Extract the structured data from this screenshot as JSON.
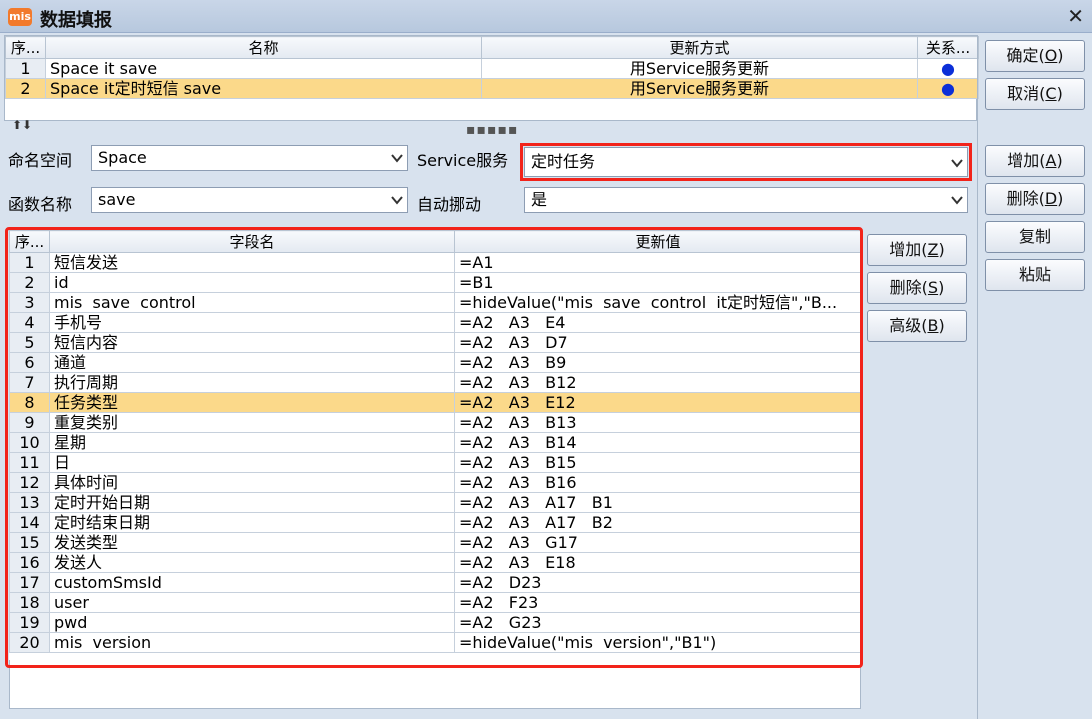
{
  "window": {
    "title": "数据填报",
    "icon_text": "mis"
  },
  "top_table": {
    "headers": [
      "序...",
      "名称",
      "更新方式",
      "关系..."
    ],
    "rows": [
      {
        "no": "1",
        "name": "Space  it  save",
        "mode": "用Service服务更新",
        "rel": "●"
      },
      {
        "no": "2",
        "name": "Space  it定时短信  save",
        "mode": "用Service服务更新",
        "rel": "●"
      }
    ],
    "selected_row": 1
  },
  "buttons_right": {
    "ok": "确定(O)",
    "cancel": "取消(C)",
    "add": "增加(A)",
    "delete": "删除(D)",
    "copy": "复制",
    "paste": "粘贴"
  },
  "form": {
    "namespace_label": "命名空间",
    "namespace_value": "Space",
    "service_label": "Service服务",
    "service_value": "定时任务",
    "function_label": "函数名称",
    "function_value": "save",
    "auto_label": "自动挪动",
    "auto_value": "是"
  },
  "field_buttons": {
    "add": "增加(Z)",
    "delete": "删除(S)",
    "advanced": "高级(B)"
  },
  "field_table": {
    "headers": [
      "序...",
      "字段名",
      "更新值"
    ],
    "selected_row": 7,
    "rows": [
      {
        "no": "1",
        "field": "短信发送",
        "value": "=A1"
      },
      {
        "no": "2",
        "field": "id",
        "value": "=B1"
      },
      {
        "no": "3",
        "field": "mis  save  control",
        "value": "=hideValue(\"mis  save  control  it定时短信\",\"B..."
      },
      {
        "no": "4",
        "field": "手机号",
        "value": "=A2   A3   E4"
      },
      {
        "no": "5",
        "field": "短信内容",
        "value": "=A2   A3   D7"
      },
      {
        "no": "6",
        "field": "通道",
        "value": "=A2   A3   B9"
      },
      {
        "no": "7",
        "field": "执行周期",
        "value": "=A2   A3   B12"
      },
      {
        "no": "8",
        "field": "任务类型",
        "value": "=A2   A3   E12"
      },
      {
        "no": "9",
        "field": "重复类别",
        "value": "=A2   A3   B13"
      },
      {
        "no": "10",
        "field": "星期",
        "value": "=A2   A3   B14"
      },
      {
        "no": "11",
        "field": "日",
        "value": "=A2   A3   B15"
      },
      {
        "no": "12",
        "field": "具体时间",
        "value": "=A2   A3   B16"
      },
      {
        "no": "13",
        "field": "定时开始日期",
        "value": "=A2   A3   A17   B1"
      },
      {
        "no": "14",
        "field": "定时结束日期",
        "value": "=A2   A3   A17   B2"
      },
      {
        "no": "15",
        "field": "发送类型",
        "value": "=A2   A3   G17"
      },
      {
        "no": "16",
        "field": "发送人",
        "value": "=A2   A3   E18"
      },
      {
        "no": "17",
        "field": "customSmsId",
        "value": "=A2   D23"
      },
      {
        "no": "18",
        "field": "user",
        "value": "=A2   F23"
      },
      {
        "no": "19",
        "field": "pwd",
        "value": "=A2   G23"
      },
      {
        "no": "20",
        "field": "mis  version",
        "value": "=hideValue(\"mis  version\",\"B1\")"
      }
    ]
  },
  "colors": {
    "accent_highlight": "#f2231a",
    "selected_row": "#fbd98a",
    "rel_dot": "#0b2fd8"
  }
}
